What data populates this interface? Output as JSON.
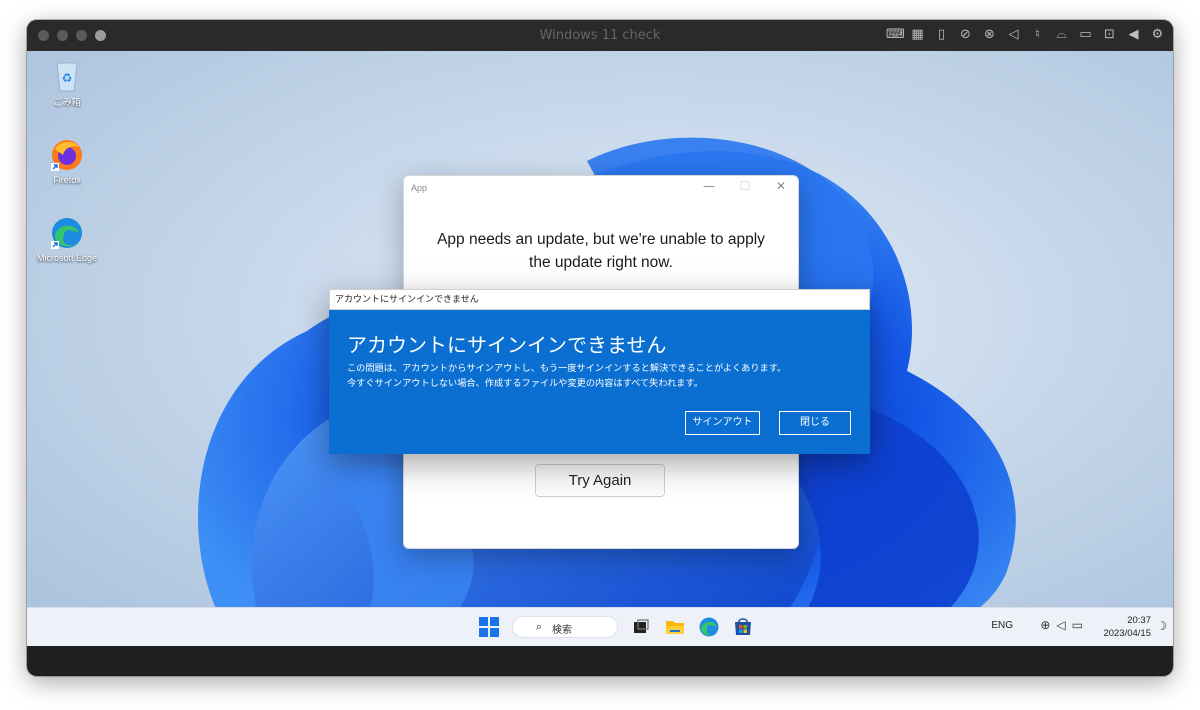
{
  "vm": {
    "title": "Windows 11 check",
    "toolbar_icons": [
      "keyboard-icon",
      "cpu-icon",
      "usb-icon",
      "no-camera-icon",
      "no-mic-icon",
      "speaker-icon",
      "microphone-icon",
      "drive-icon",
      "video-off-icon",
      "folder-share-icon",
      "back-triangle-icon",
      "gear-icon"
    ]
  },
  "desktop_icons": [
    {
      "label": "ごみ箱",
      "icon": "recycle-bin-icon"
    },
    {
      "label": "Firefox",
      "icon": "firefox-icon"
    },
    {
      "label": "Microsoft Edge",
      "icon": "edge-icon"
    }
  ],
  "app_window": {
    "title": "App",
    "minimize": "—",
    "maximize": "☐",
    "close": "✕",
    "message_line1": "App needs an update, but we're unable to apply",
    "message_line2": "the update right now.",
    "try_again_label": "Try Again"
  },
  "dialog": {
    "window_title": "アカウントにサインインできません",
    "heading": "アカウントにサインインできません",
    "body_line1": "この問題は、アカウントからサインアウトし、もう一度サインインすると解決できることがよくあります。",
    "body_line2": "今すぐサインアウトしない場合、作成するファイルや変更の内容はすべて失われます。",
    "signout_label": "サインアウト",
    "close_label": "閉じる"
  },
  "taskbar": {
    "search_label": "検索",
    "search_icon": "⌕",
    "language": "ENG",
    "time": "20:37",
    "date": "2023/04/15"
  },
  "colors": {
    "dialog_blue": "#0a6fd1",
    "taskbar_bg": "#eef2f8",
    "start_blue": "#1a73e8"
  }
}
